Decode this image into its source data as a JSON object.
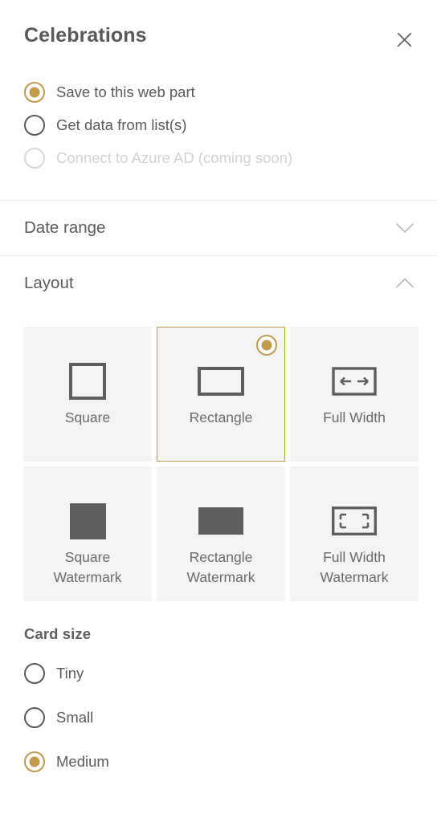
{
  "header": {
    "title": "Celebrations",
    "close_label": "Close",
    "close_icon": "close-icon"
  },
  "data_source": {
    "options": [
      {
        "label": "Save to this web part",
        "selected": true,
        "disabled": false
      },
      {
        "label": "Get data from list(s)",
        "selected": false,
        "disabled": false
      },
      {
        "label": "Connect to Azure AD (coming soon)",
        "selected": false,
        "disabled": true
      }
    ]
  },
  "sections": {
    "date_range": {
      "title": "Date range",
      "expanded": false,
      "chevron_icon": "chevron-down-icon"
    },
    "layout": {
      "title": "Layout",
      "expanded": true,
      "chevron_icon": "chevron-up-icon"
    }
  },
  "layout_tiles": [
    {
      "label": "Square",
      "icon": "square-outline-icon",
      "selected": false
    },
    {
      "label": "Rectangle",
      "icon": "rectangle-outline-icon",
      "selected": true
    },
    {
      "label": "Full Width",
      "icon": "full-width-arrows-icon",
      "selected": false
    },
    {
      "label": "Square\nWatermark",
      "icon": "square-filled-icon",
      "selected": false
    },
    {
      "label": "Rectangle\nWatermark",
      "icon": "rectangle-filled-icon",
      "selected": false
    },
    {
      "label": "Full Width\nWatermark",
      "icon": "full-width-brackets-icon",
      "selected": false
    }
  ],
  "card_size": {
    "title": "Card size",
    "options": [
      {
        "label": "Tiny",
        "selected": false
      },
      {
        "label": "Small",
        "selected": false
      },
      {
        "label": "Medium",
        "selected": true
      }
    ]
  },
  "colors": {
    "accent": "#c19a4e",
    "text": "#5a5a5a",
    "tile_bg": "#f4f4f4",
    "divider": "#ededed",
    "icon_gray": "#5e5e5e",
    "disabled": "#d2d2d2"
  }
}
